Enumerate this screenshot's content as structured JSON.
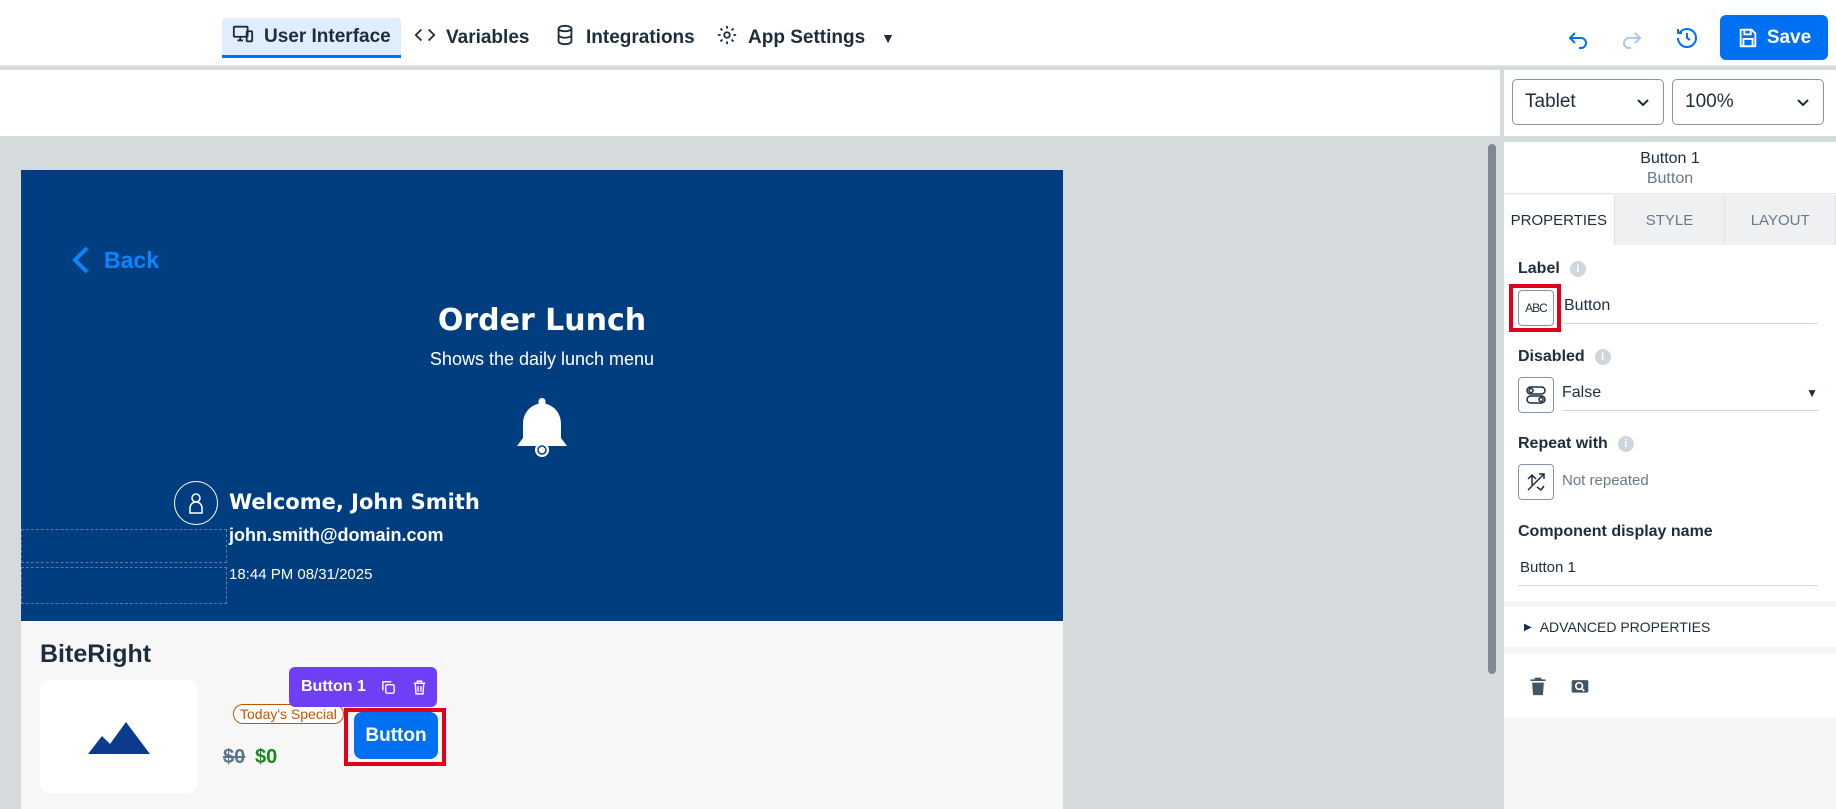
{
  "topbar": {
    "tabs": [
      {
        "label": "User Interface",
        "icon": "monitor-phone-icon",
        "active": true
      },
      {
        "label": "Variables",
        "icon": "code-icon"
      },
      {
        "label": "Integrations",
        "icon": "database-icon"
      },
      {
        "label": "App Settings",
        "icon": "gear-icon"
      }
    ],
    "save_label": "Save",
    "accent": "#0070f2"
  },
  "toolbar": {
    "device": "Tablet",
    "zoom": "100%"
  },
  "preview": {
    "back_label": "Back",
    "title": "Order Lunch",
    "subtitle": "Shows the daily lunch menu",
    "welcome": "Welcome, John Smith",
    "email": "john.smith@domain.com",
    "datetime": "18:44 PM 08/31/2025",
    "brand": "BiteRight",
    "special_badge": "Today's Special",
    "price_old": "$0",
    "price_new": "$0",
    "button_label": "Button",
    "selection_label": "Button 1",
    "header_color": "#003e80"
  },
  "panel": {
    "component_name": "Button 1",
    "component_type": "Button",
    "tabs": [
      "PROPERTIES",
      "STYLE",
      "LAYOUT"
    ],
    "active_tab": "PROPERTIES",
    "label_title": "Label",
    "label_value": "Button",
    "label_type_glyph": "ABC",
    "disabled_title": "Disabled",
    "disabled_value": "False",
    "repeat_title": "Repeat with",
    "repeat_value": "Not repeated",
    "display_name_title": "Component display name",
    "display_name_value": "Button 1",
    "advanced_label": "ADVANCED PROPERTIES"
  }
}
